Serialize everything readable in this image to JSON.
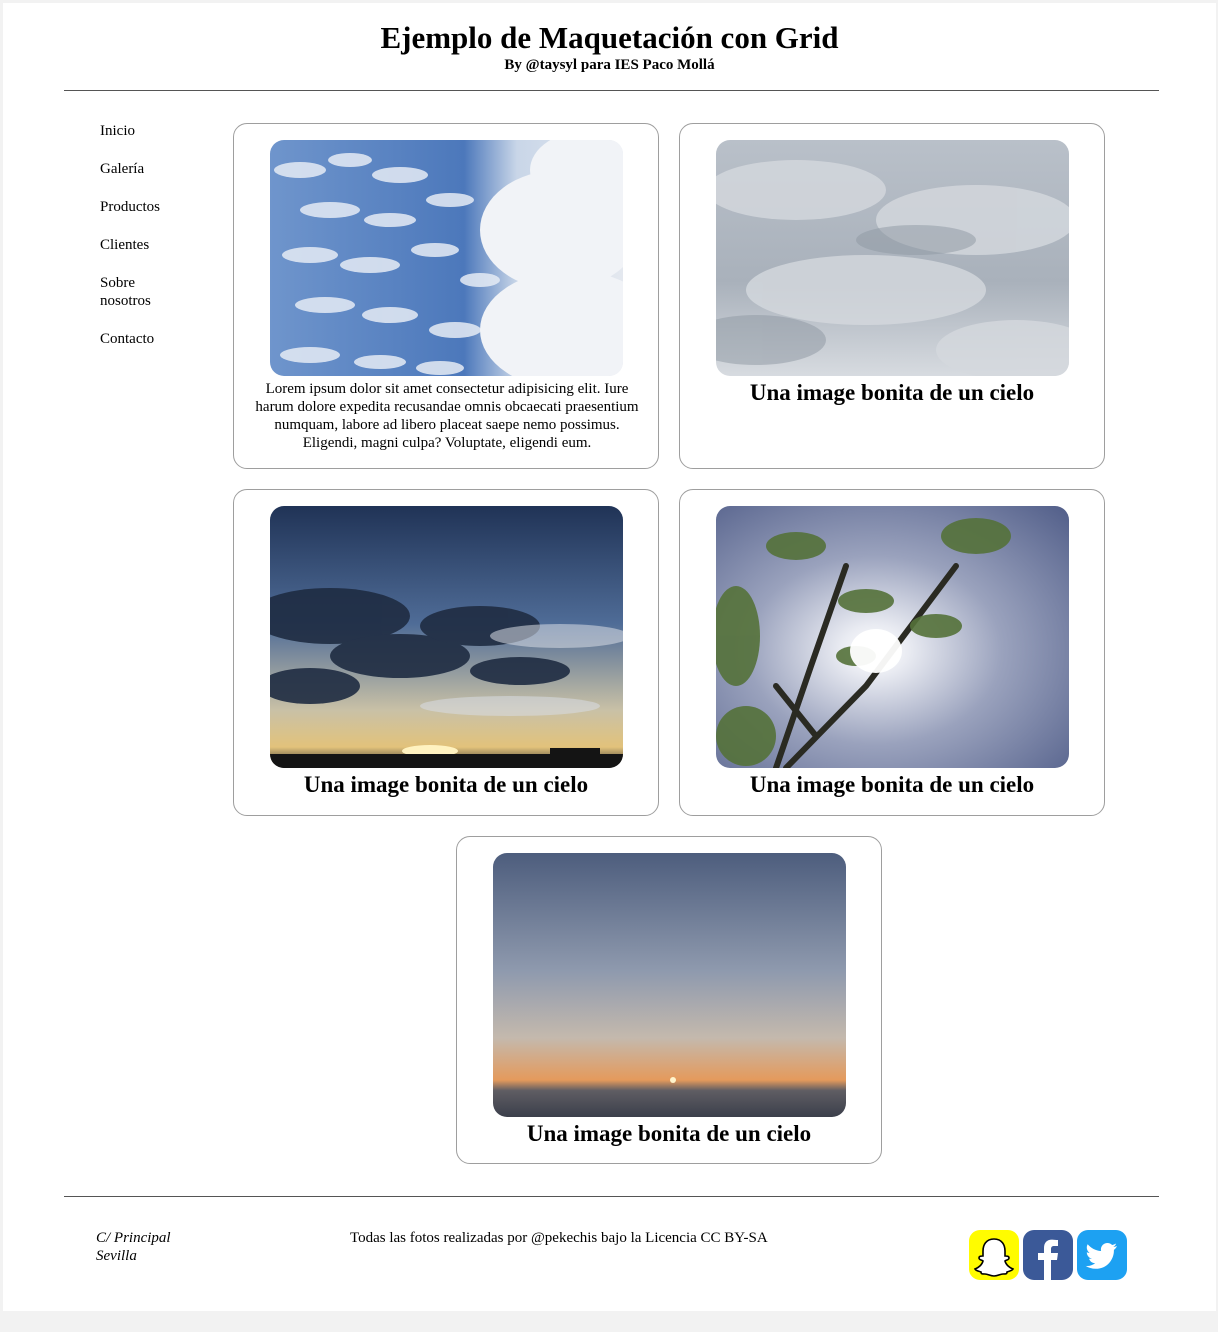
{
  "header": {
    "title": "Ejemplo de Maquetación con Grid",
    "subtitle": "By @taysyl para IES Paco Mollá"
  },
  "nav": {
    "items": [
      {
        "label": "Inicio"
      },
      {
        "label": "Galería"
      },
      {
        "label": "Productos"
      },
      {
        "label": "Clientes"
      },
      {
        "label": "Sobre nosotros"
      },
      {
        "label": "Contacto"
      }
    ]
  },
  "gallery": {
    "cards": [
      {
        "image": "sky-clouds-blue-photo",
        "text": "Lorem ipsum dolor sit amet consectetur adipisicing elit. Iure harum dolore expedita recusandae omnis obcaecati praesentium numquam, labore ad libero placeat saepe nemo possimus. Eligendi, magni culpa? Voluptate, eligendi eum."
      },
      {
        "image": "overcast-sky-photo",
        "caption": "Una image bonita de un cielo"
      },
      {
        "image": "sunset-clouds-photo",
        "caption": "Una image bonita de un cielo"
      },
      {
        "image": "tree-sun-sky-photo",
        "caption": "Una image bonita de un cielo"
      },
      {
        "image": "sea-sunset-photo",
        "caption": "Una image bonita de un cielo"
      }
    ]
  },
  "footer": {
    "address_line1": "C/ Principal",
    "address_line2": "Sevilla",
    "credits": "Todas las fotos realizadas por @pekechis bajo la Licencia CC BY-SA",
    "social": [
      {
        "icon": "snapchat-icon",
        "color": "#fffc00"
      },
      {
        "icon": "facebook-icon",
        "color": "#3b5998"
      },
      {
        "icon": "twitter-icon",
        "color": "#1da1f2"
      }
    ]
  },
  "colors": {
    "card_border": "#9e9e9e",
    "rule": "#555555"
  }
}
